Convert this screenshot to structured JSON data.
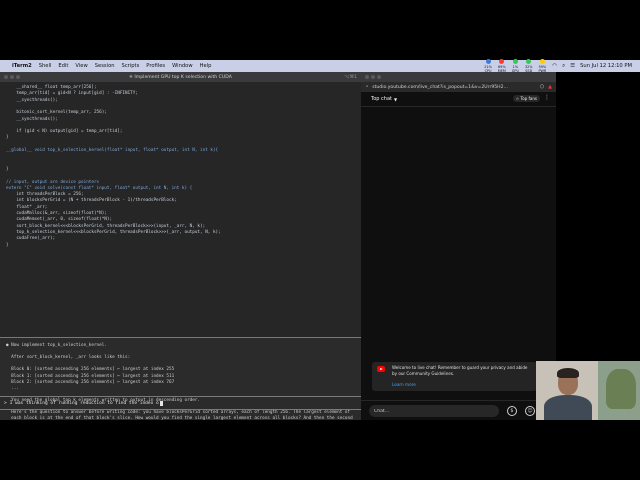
{
  "menubar": {
    "apple_icon": "apple-icon",
    "app": "iTerm2",
    "items": [
      "Shell",
      "Edit",
      "View",
      "Session",
      "Scripts",
      "Profiles",
      "Window",
      "Help"
    ],
    "stats": [
      {
        "value": "21%",
        "label": "CPU",
        "color": "#3a7be0"
      },
      {
        "value": "69%",
        "label": "MEM",
        "color": "#ff3b30"
      },
      {
        "value": "1%",
        "label": "GPU",
        "color": "#34c759"
      },
      {
        "value": "32%",
        "label": "SSD",
        "color": "#34c759"
      },
      {
        "value": "59%",
        "label": "PWR",
        "color": "#ffcc00"
      }
    ],
    "clock": "Sun Jul 12  12:10 PM"
  },
  "terminal": {
    "title": "✳ Implement GPU top K selection with CUDA",
    "shortcut": "⌥⌘1",
    "code_lines": [
      "    __shared__ float temp_arr[256];",
      "    temp_arr[tid] = gid<N ? input[gid] : -INFINITY;",
      "    __syncthreads();",
      "",
      "    bitonic_sort_kernel(temp_arr, 256);",
      "    __syncthreads();",
      "",
      "    if (gid < N) output[gid] = temp_arr[tid];",
      "}",
      "",
      "__global__ void top_k_selection_kernel(float* input, float* output, int N, int k){",
      "",
      "",
      "}",
      "",
      "// input, output are device pointers",
      "extern \"C\" void solve(const float* input, float* output, int N, int k) {",
      "    int threadsPerBlock = 256;",
      "    int blocksPerGrid = (N + threadsPerBlock - 1)/threadsPerBlock;",
      "    float* _arr;",
      "    cudaMalloc(&_arr, sizeof(float)*N);",
      "    cudaMemset(_arr, 0, sizeof(float)*N);",
      "    sort_block_kernel<<<blocksPerGrid, threadsPerBlock>>>(input, _arr, N, k);",
      "    top_k_selection_kernel<<<blocksPerGrid, threadsPerBlock>>>(_arr, output, N, k);",
      "    cudaFree(_arr);",
      "}"
    ],
    "chat_lines": [
      {
        "text": "● Now implement top_k_selection_kernel.",
        "style": ""
      },
      {
        "text": "",
        "style": ""
      },
      {
        "text": "  After sort_block_kernel, _arr looks like this:",
        "style": ""
      },
      {
        "text": "",
        "style": ""
      },
      {
        "text": "  Block 0: [sorted ascending 256 elements] ← largest at index 255",
        "style": ""
      },
      {
        "text": "  Block 1: [sorted ascending 256 elements] ← largest at index 511",
        "style": ""
      },
      {
        "text": "  Block 2: [sorted ascending 256 elements] ← largest at index 767",
        "style": ""
      },
      {
        "text": "  ...",
        "style": ""
      },
      {
        "text": "",
        "style": ""
      },
      {
        "text": "  You need the global top k elements written to output in descending order.",
        "style": ""
      },
      {
        "text": "",
        "style": ""
      },
      {
        "text": "  Here's the question to answer before writing code: you have blocksPerGrid sorted arrays, each of length 256. The largest element of",
        "style": ""
      },
      {
        "text": "  each block is at the end of that block's slice. How would you find the single largest element across all blocks? And then the second",
        "style": ""
      },
      {
        "text": "  largest? Think about it like reading from the back of each sorted block simultaneously.",
        "style": ""
      },
      {
        "text": "",
        "style": ""
      },
      {
        "text": "  What's your instinct for how to do this?",
        "style": ""
      },
      {
        "text": "",
        "style": ""
      },
      {
        "text": "✻ Worked for 5s",
        "style": "accent"
      }
    ],
    "update_notice": "Update available! Run: brew upgrade claude-code",
    "prompt_symbol": ">",
    "prompt_text": "I was thinking of running reduction to find the index o"
  },
  "browser": {
    "url": "studio.youtube.com/live_chat?is_popout=1&v=2Urr95H2...",
    "chat_header_title": "Top chat",
    "top_fans_label": "Top fans",
    "welcome_message": "Welcome to live chat! Remember to guard your privacy and abide by our Community Guidelines.",
    "learn_more": "Learn more",
    "chat_placeholder": "Chat..."
  }
}
